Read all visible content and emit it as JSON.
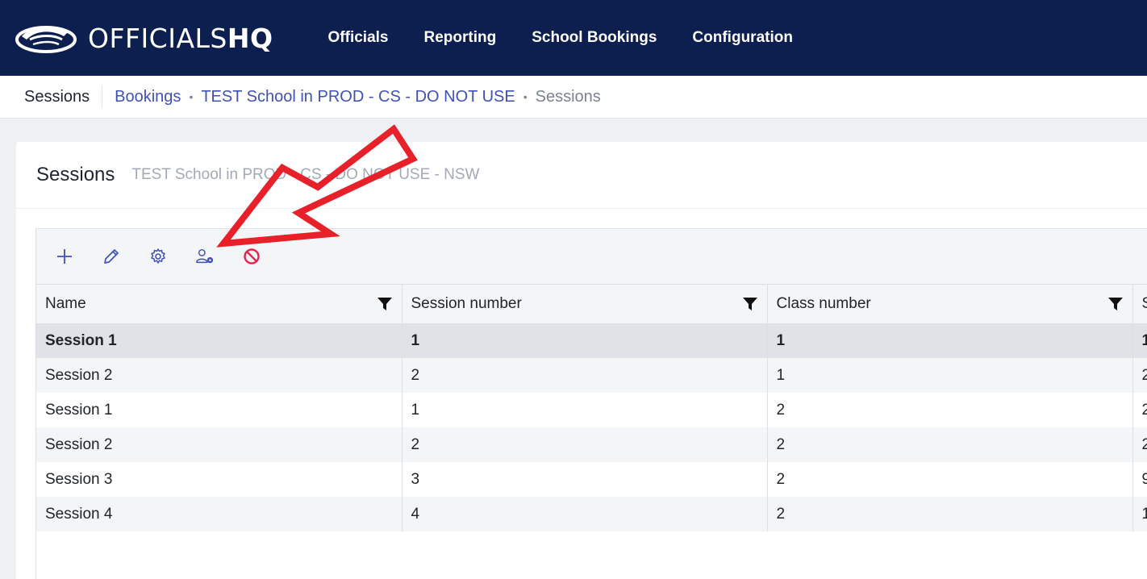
{
  "brand": {
    "name_light": "OFFICIALS",
    "name_bold": "HQ"
  },
  "nav": {
    "items": [
      {
        "label": "Officials"
      },
      {
        "label": "Reporting"
      },
      {
        "label": "School Bookings"
      },
      {
        "label": "Configuration"
      }
    ]
  },
  "breadcrumb": {
    "section": "Sessions",
    "links": [
      "Bookings",
      "TEST School in PROD - CS - DO NOT USE"
    ],
    "current": "Sessions",
    "separator": "•"
  },
  "card": {
    "title": "Sessions",
    "subtitle": "TEST School in PROD - CS - DO NOT USE - NSW"
  },
  "toolbar": {
    "icons": [
      "plus-icon",
      "pencil-icon",
      "gear-icon",
      "user-gear-icon",
      "cancel-icon"
    ],
    "cancel_color": "#e2264d",
    "icon_color": "#3f51b5"
  },
  "grid": {
    "columns": [
      "Name",
      "Session number",
      "Class number",
      "S"
    ],
    "rows": [
      {
        "name": "Session 1",
        "session": "1",
        "class": "1",
        "extra": "1",
        "selected": true
      },
      {
        "name": "Session 2",
        "session": "2",
        "class": "1",
        "extra": "2"
      },
      {
        "name": "Session 1",
        "session": "1",
        "class": "2",
        "extra": "2"
      },
      {
        "name": "Session 2",
        "session": "2",
        "class": "2",
        "extra": "2"
      },
      {
        "name": "Session 3",
        "session": "3",
        "class": "2",
        "extra": "9"
      },
      {
        "name": "Session 4",
        "session": "4",
        "class": "2",
        "extra": "1"
      }
    ]
  },
  "colors": {
    "nav_bg": "#0c1f4f",
    "link": "#3f51b5",
    "annotation_arrow": "#e8202a"
  }
}
